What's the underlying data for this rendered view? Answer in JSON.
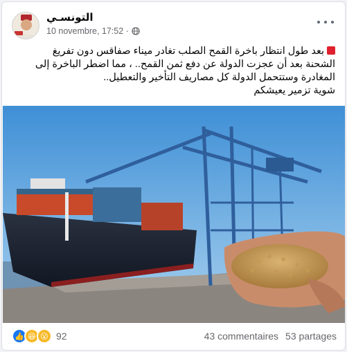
{
  "post": {
    "author": "التونسـي",
    "timestamp": "10 novembre, 17:52 ·",
    "audience_icon": "globe-icon",
    "text_lines": [
      "بعد طول انتظار باخرة القمح الصلب تغادر ميناء صفاقس دون تفريغ",
      "الشحنة بعد أن عجزت الدولة عن دفع ثمن القمح.. ، مما اضطر الباخرة إلى",
      "المغادرة وستتحمل الدولة كل مصاريف التأخير والتعطيل..",
      "شوية تزمير يعيشكم"
    ],
    "image_description_icon": "cargo-ship-wheat-photo"
  },
  "footer": {
    "reaction_icons": [
      "like-icon",
      "haha-icon",
      "wow-icon"
    ],
    "reaction_count": "92",
    "comments": "43 commentaires",
    "shares": "53 partages"
  },
  "colors": {
    "like": "#1877f2",
    "haha": "#f7b928",
    "accent_red": "#e0202c"
  }
}
